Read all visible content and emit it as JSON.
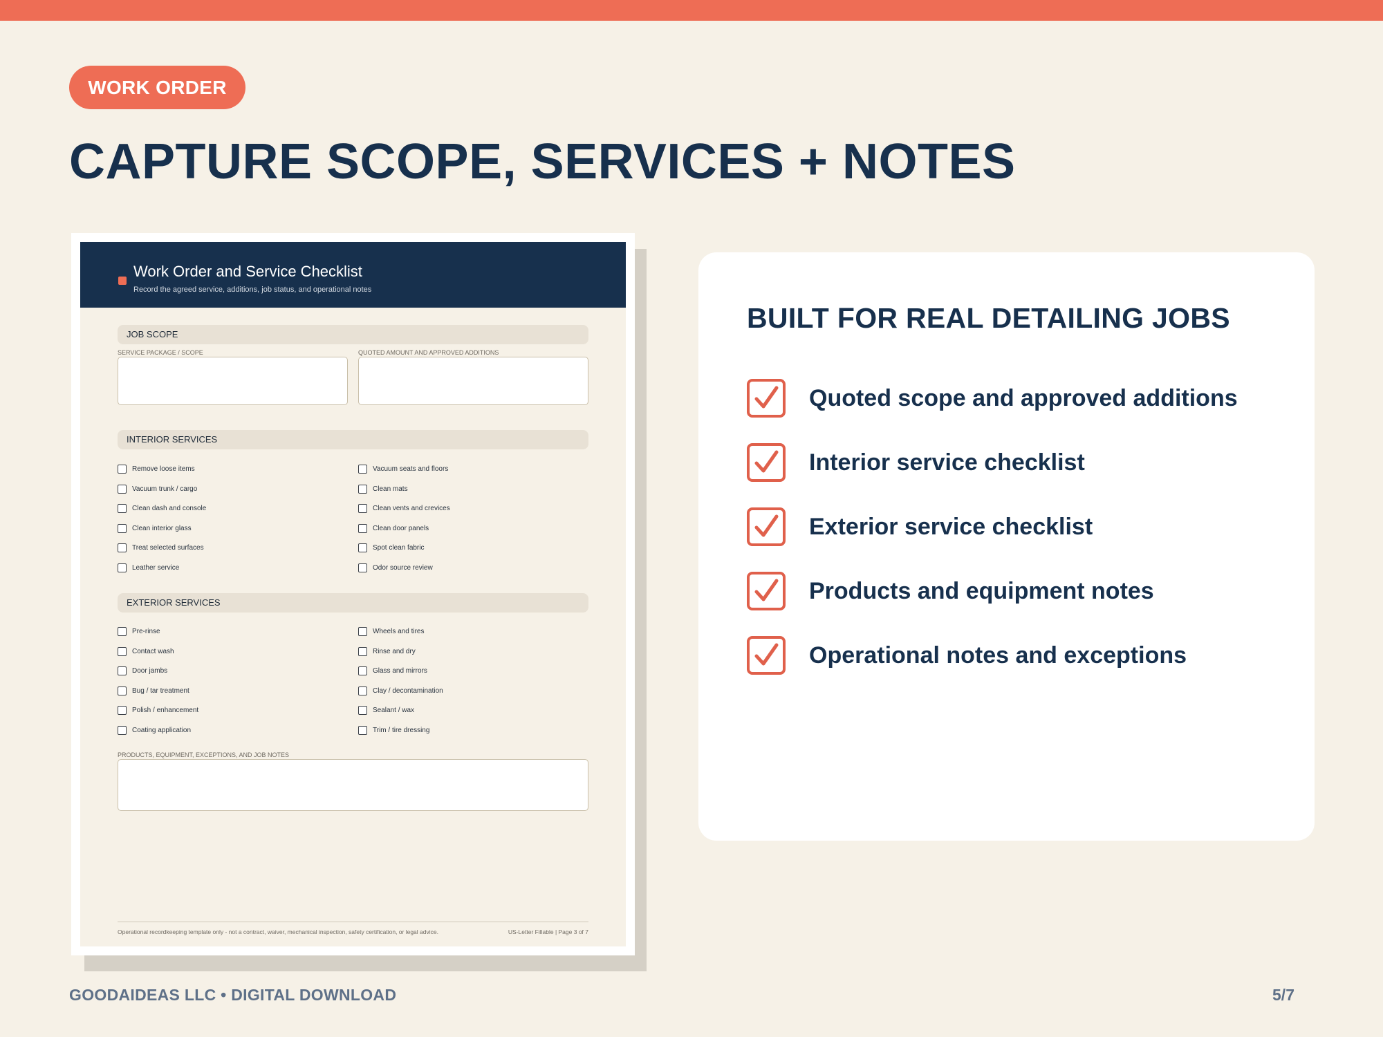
{
  "badge": "WORK ORDER",
  "title": "CAPTURE SCOPE, SERVICES + NOTES",
  "document": {
    "header_title": "Work Order and Service Checklist",
    "header_subtitle": "Record the agreed service, additions, job status, and operational notes",
    "job_scope": {
      "heading": "JOB SCOPE",
      "field_left_label": "SERVICE PACKAGE / SCOPE",
      "field_right_label": "QUOTED AMOUNT AND APPROVED ADDITIONS"
    },
    "interior": {
      "heading": "INTERIOR SERVICES",
      "left": [
        "Remove loose items",
        "Vacuum trunk / cargo",
        "Clean dash and console",
        "Clean interior glass",
        "Treat selected surfaces",
        "Leather service"
      ],
      "right": [
        "Vacuum seats and floors",
        "Clean mats",
        "Clean vents and crevices",
        "Clean door panels",
        "Spot clean fabric",
        "Odor source review"
      ]
    },
    "exterior": {
      "heading": "EXTERIOR SERVICES",
      "left": [
        "Pre-rinse",
        "Contact wash",
        "Door jambs",
        "Bug / tar treatment",
        "Polish / enhancement",
        "Coating application"
      ],
      "right": [
        "Wheels and tires",
        "Rinse and dry",
        "Glass and mirrors",
        "Clay / decontamination",
        "Sealant / wax",
        "Trim / tire dressing"
      ]
    },
    "notes_label": "PRODUCTS, EQUIPMENT, EXCEPTIONS, AND JOB NOTES",
    "footer_left": "Operational recordkeeping template only - not a contract, waiver, mechanical inspection, safety certification, or legal advice.",
    "footer_right": "US-Letter Fillable | Page 3 of 7"
  },
  "card": {
    "title": "BUILT FOR REAL DETAILING JOBS",
    "features": [
      "Quoted scope and approved additions",
      "Interior service checklist",
      "Exterior service checklist",
      "Products and equipment notes",
      "Operational notes and exceptions"
    ]
  },
  "footer": {
    "brand": "GOODAIDEAS LLC • DIGITAL DOWNLOAD",
    "page": "5/7"
  },
  "colors": {
    "accent": "#ee6d55",
    "navy": "#17304d",
    "background": "#f6f1e7"
  },
  "icons": {
    "feature_check": "checkbox-check-icon",
    "doc_checkbox": "empty-checkbox-icon"
  }
}
